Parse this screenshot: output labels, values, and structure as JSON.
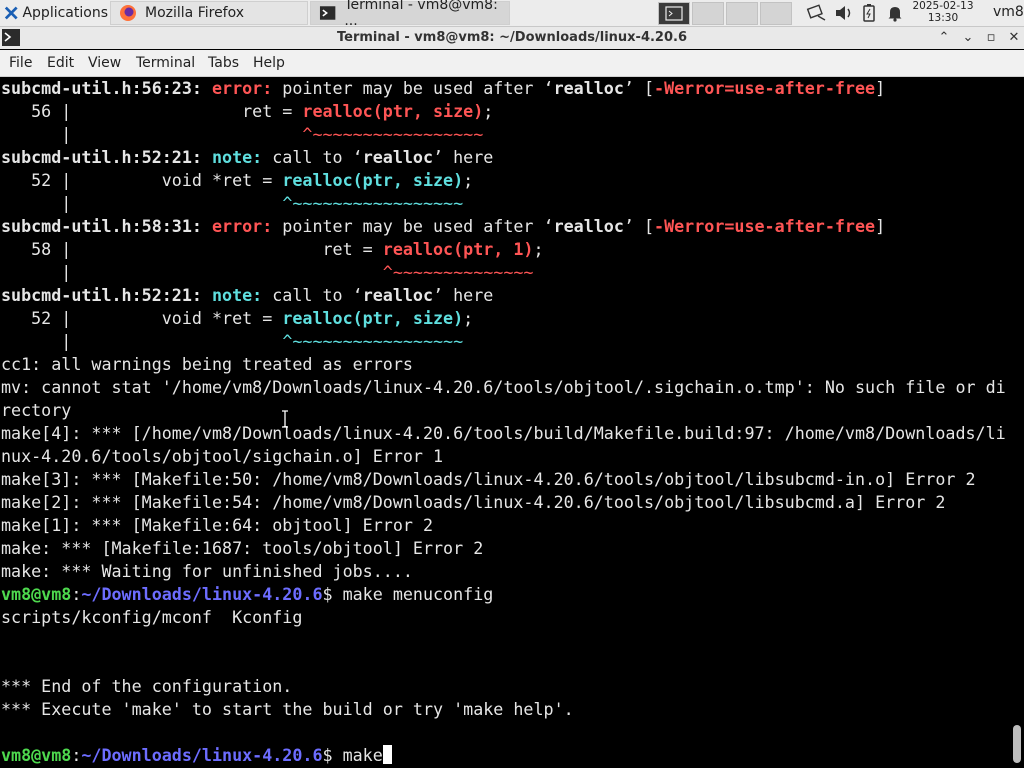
{
  "taskbar": {
    "applications_label": "Applications",
    "tasks": [
      {
        "label": "Mozilla Firefox",
        "icon": "firefox-icon"
      },
      {
        "label": "Terminal - vm8@vm8: ...",
        "icon": "terminal-icon"
      }
    ],
    "clock_date": "2025-02-13",
    "clock_time": "13:30",
    "user": "vm8"
  },
  "window": {
    "title": "Terminal - vm8@vm8: ~/Downloads/linux-4.20.6"
  },
  "menu": [
    "File",
    "Edit",
    "View",
    "Terminal",
    "Tabs",
    "Help"
  ],
  "terminal": {
    "lines": [
      "subcmd-util.h:56:23: error: pointer may be used after ‘realloc’ [-Werror=use-after-free]",
      "   56 |                 ret = realloc(ptr, size);",
      "      |                       ^~~~~~~~~~~~~~~~~~",
      "subcmd-util.h:52:21: note: call to ‘realloc’ here",
      "   52 |         void *ret = realloc(ptr, size);",
      "      |                     ^~~~~~~~~~~~~~~~~~",
      "subcmd-util.h:58:31: error: pointer may be used after ‘realloc’ [-Werror=use-after-free]",
      "   58 |                         ret = realloc(ptr, 1);",
      "      |                               ^~~~~~~~~~~~~~~",
      "subcmd-util.h:52:21: note: call to ‘realloc’ here",
      "   52 |         void *ret = realloc(ptr, size);",
      "      |                     ^~~~~~~~~~~~~~~~~~",
      "cc1: all warnings being treated as errors",
      "mv: cannot stat '/home/vm8/Downloads/linux-4.20.6/tools/objtool/.sigchain.o.tmp': No such file or di",
      "rectory",
      "make[4]: *** [/home/vm8/Downloads/linux-4.20.6/tools/build/Makefile.build:97: /home/vm8/Downloads/li",
      "nux-4.20.6/tools/objtool/sigchain.o] Error 1",
      "make[3]: *** [Makefile:50: /home/vm8/Downloads/linux-4.20.6/tools/objtool/libsubcmd-in.o] Error 2",
      "make[2]: *** [Makefile:54: /home/vm8/Downloads/linux-4.20.6/tools/objtool/libsubcmd.a] Error 2",
      "make[1]: *** [Makefile:64: objtool] Error 2",
      "make: *** [Makefile:1687: tools/objtool] Error 2",
      "make: *** Waiting for unfinished jobs....",
      "",
      "scripts/kconfig/mconf  Kconfig",
      "",
      "",
      "*** End of the configuration.",
      "*** Execute 'make' to start the build or try 'make help'.",
      "",
      ""
    ],
    "prompt_user": "vm8@vm8",
    "prompt_path": "~/Downloads/linux-4.20.6",
    "prompt_1_cmd": "make menuconfig",
    "prompt_2_cmd": "make"
  },
  "colors": {
    "error": "#ff5555",
    "note": "#5fdfdf",
    "prompt_user": "#4ed94e",
    "prompt_path": "#6d6dff"
  }
}
